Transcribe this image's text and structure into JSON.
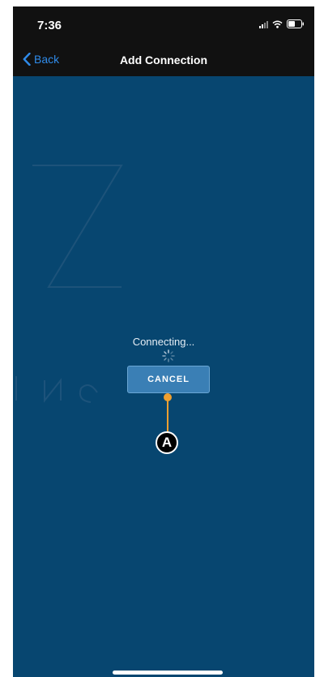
{
  "status_bar": {
    "time": "7:36",
    "icons": [
      "signal-icon",
      "wifi-icon",
      "battery-icon"
    ]
  },
  "nav": {
    "back_label": "Back",
    "title": "Add Connection"
  },
  "main": {
    "status_text": "Connecting...",
    "cancel_label": "CANCEL"
  },
  "annotation": {
    "label": "A"
  },
  "colors": {
    "background": "#074670",
    "bar": "#111111",
    "link": "#2f8bea",
    "button": "#3a7fb5",
    "callout": "#f0a030"
  }
}
